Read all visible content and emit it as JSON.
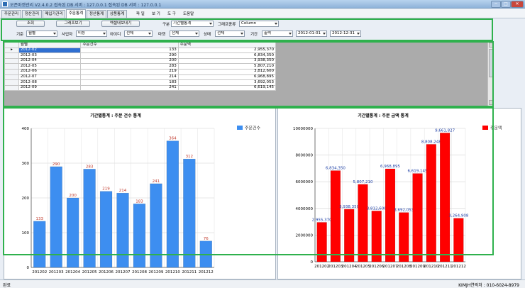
{
  "window": {
    "title": "오픈마켓관리 V2.4.0.2 접속된 DB 서버 : 127.0.0.1 접속된 DB 서버 : 127.0.0.1",
    "min_label": "─",
    "max_label": "□",
    "close_label": "✕"
  },
  "tabs": [
    "주문관리",
    "정산관리",
    "매입가관리",
    "주문통계",
    "정산통계",
    "상품통계"
  ],
  "active_tab": "주문통계",
  "menu": [
    "파 일",
    "보 기",
    "도 구",
    "도움말"
  ],
  "toolbar": {
    "search_button": "조회",
    "graph_button": "그래프보기",
    "excel_button": "엑셀내보내기",
    "type_label": "구분",
    "type_value": "기간별통계",
    "graph_type_label": "그래프종류",
    "graph_type_value": "Column",
    "basis_label": "기준",
    "basis_value": "월별",
    "business_label": "사업자",
    "business_value": "미능",
    "id_label": "아이디",
    "id_value": "전체",
    "market_label": "마켓",
    "market_value": "전체",
    "status_label": "상태",
    "status_value": "전체",
    "period_label": "기간",
    "period_value": "출력",
    "date_from": "2012-01-01",
    "date_to": "2012-12-31"
  },
  "grid": {
    "headers": [
      "월별",
      "주문건수",
      "주문액"
    ],
    "rows": [
      [
        "2012-02",
        "133",
        "2,955,370"
      ],
      [
        "2012-03",
        "290",
        "6,834,350"
      ],
      [
        "2012-04",
        "200",
        "3,938,350"
      ],
      [
        "2012-05",
        "283",
        "5,807,210"
      ],
      [
        "2012-06",
        "219",
        "3,812,600"
      ],
      [
        "2012-07",
        "214",
        "6,968,895"
      ],
      [
        "2012-08",
        "183",
        "3,692,053"
      ],
      [
        "2012-09",
        "241",
        "6,619,145"
      ]
    ]
  },
  "chart_data": [
    {
      "type": "bar",
      "title": "기간별통계 : 주문 건수 통계",
      "legend": "주문건수",
      "legend_position": "top-right",
      "color": "#3d8ef0",
      "categories": [
        "201202",
        "201203",
        "201204",
        "201205",
        "201206",
        "201207",
        "201208",
        "201209",
        "201210",
        "201211",
        "201212"
      ],
      "values": [
        133,
        290,
        200,
        283,
        219,
        214,
        183,
        241,
        364,
        312,
        76
      ],
      "data_labels": [
        "133",
        "290",
        "200",
        "283",
        "219",
        "214",
        "183",
        "241",
        "364",
        "312",
        "76"
      ],
      "label_color": "#c0392b",
      "ylim": [
        0,
        400
      ],
      "yticks": [
        "0",
        "100",
        "200",
        "300",
        "400"
      ],
      "grid": true
    },
    {
      "type": "bar",
      "title": "기간별통계 : 주문 금액 통계",
      "legend": "주문액",
      "legend_position": "top-right",
      "color": "#ff0000",
      "categories": [
        "201202",
        "201203",
        "201204",
        "201205",
        "201206",
        "201207",
        "201208",
        "201209",
        "201210",
        "201211",
        "201212"
      ],
      "values": [
        2955370,
        6834350,
        3938350,
        5807210,
        3812600,
        6968895,
        3692053,
        6619145,
        8808248,
        9661827,
        3264908
      ],
      "data_labels": [
        "2,955,370",
        "6,834,350",
        "3,938,350",
        "5,807,210",
        "3,812,600",
        "6,968,895",
        "3,692,053",
        "6,619,145",
        "8,808,248",
        "9,661,827",
        "3,264,908"
      ],
      "label_color": "#1d3fa6",
      "ylim": [
        0,
        10000000
      ],
      "yticks": [
        "0",
        "2000000",
        "4000000",
        "6000000",
        "8000000",
        "10000000"
      ],
      "xtick_labels": [
        "201202",
        "201203",
        "201204",
        "201205",
        "201206",
        "201207",
        "201208",
        "201209",
        "201210",
        "201211",
        "201212"
      ],
      "grid": true
    }
  ],
  "statusbar": {
    "left": "완료",
    "right": "KIMJH연락처 : 010-6024-8979"
  }
}
